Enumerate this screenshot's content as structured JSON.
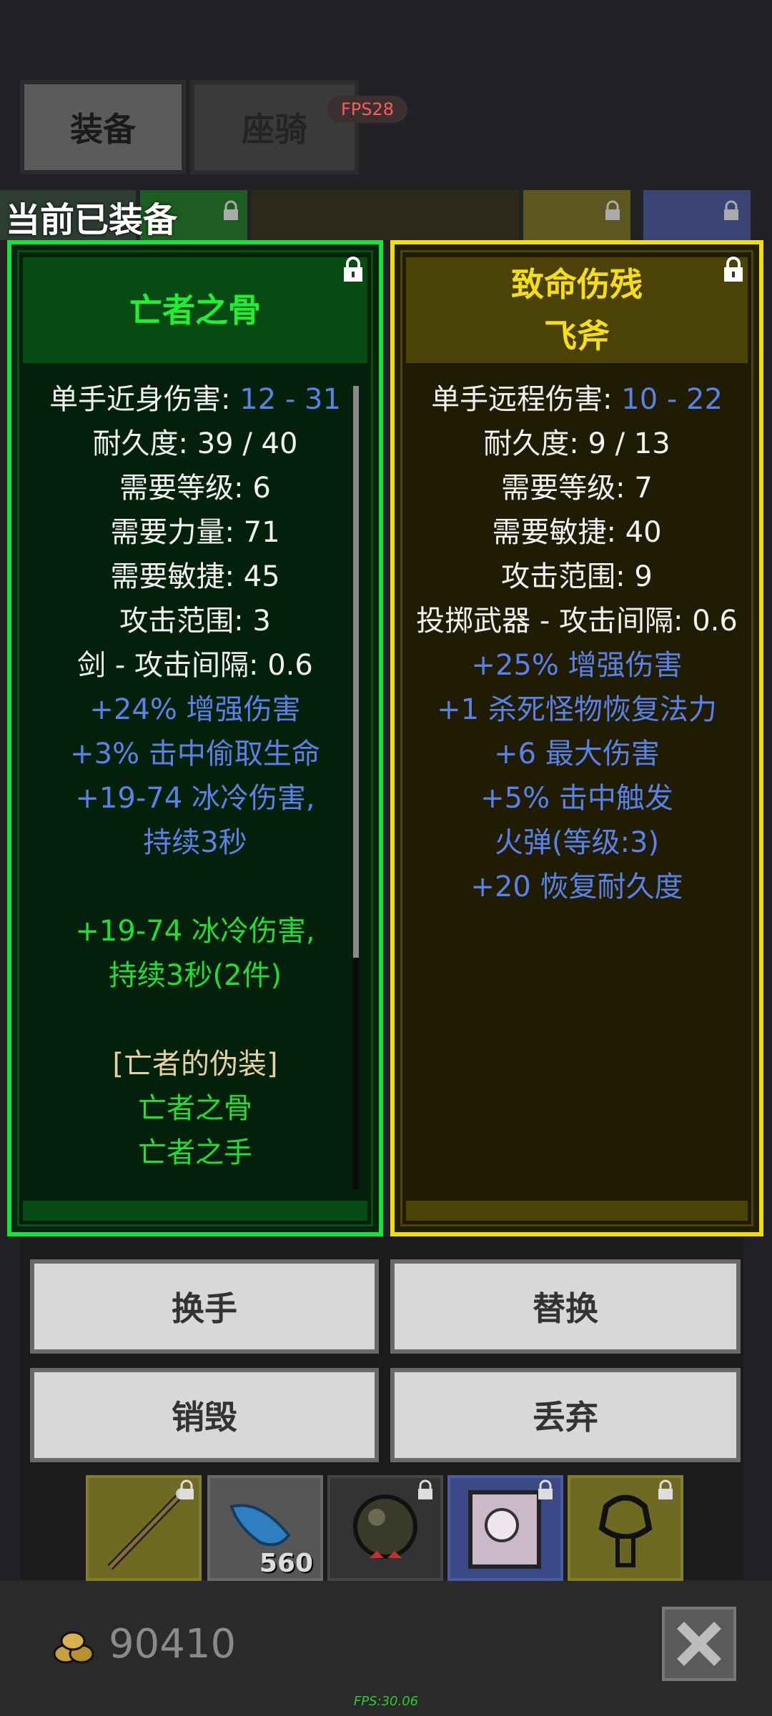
{
  "tabs": {
    "equip_label": "装备",
    "mount_label": "座骑"
  },
  "fps_badge": "FPS28",
  "equipped_title": "当前已装备",
  "left_item": {
    "title_lines": [
      "亡者之骨"
    ],
    "stats": [
      {
        "parts": [
          {
            "t": "单手近身伤害: ",
            "c": "w"
          },
          {
            "t": "12 - 31",
            "c": "b"
          }
        ]
      },
      {
        "parts": [
          {
            "t": "耐久度: 39 / 40",
            "c": "w"
          }
        ]
      },
      {
        "parts": [
          {
            "t": "需要等级: 6",
            "c": "w"
          }
        ]
      },
      {
        "parts": [
          {
            "t": "需要力量: 71",
            "c": "w"
          }
        ]
      },
      {
        "parts": [
          {
            "t": "需要敏捷: 45",
            "c": "w"
          }
        ]
      },
      {
        "parts": [
          {
            "t": "攻击范围: 3",
            "c": "w"
          }
        ]
      },
      {
        "parts": [
          {
            "t": "剑 - 攻击间隔: 0.6",
            "c": "w"
          }
        ]
      },
      {
        "parts": [
          {
            "t": "+24% 增强伤害",
            "c": "b"
          }
        ]
      },
      {
        "parts": [
          {
            "t": "+3% 击中偷取生命",
            "c": "b"
          }
        ]
      },
      {
        "parts": [
          {
            "t": "+19-74 冰冷伤害,",
            "c": "b"
          }
        ]
      },
      {
        "parts": [
          {
            "t": "持续3秒",
            "c": "b"
          }
        ]
      },
      {
        "gap": true
      },
      {
        "parts": [
          {
            "t": "+19-74 冰冷伤害,",
            "c": "g"
          }
        ]
      },
      {
        "parts": [
          {
            "t": "持续3秒(2件)",
            "c": "g"
          }
        ]
      },
      {
        "gap": true
      },
      {
        "parts": [
          {
            "t": "[亡者的伪装]",
            "c": "t"
          }
        ]
      },
      {
        "parts": [
          {
            "t": "亡者之骨",
            "c": "g"
          }
        ]
      },
      {
        "parts": [
          {
            "t": "亡者之手",
            "c": "g"
          }
        ]
      }
    ]
  },
  "right_item": {
    "title_lines": [
      "致命伤残",
      "飞斧"
    ],
    "stats": [
      {
        "parts": [
          {
            "t": "单手远程伤害: ",
            "c": "w"
          },
          {
            "t": "10 - 22",
            "c": "b"
          }
        ]
      },
      {
        "parts": [
          {
            "t": "耐久度: 9 / 13",
            "c": "w"
          }
        ]
      },
      {
        "parts": [
          {
            "t": "需要等级: 7",
            "c": "w"
          }
        ]
      },
      {
        "parts": [
          {
            "t": "需要敏捷: 40",
            "c": "w"
          }
        ]
      },
      {
        "parts": [
          {
            "t": "攻击范围: 9",
            "c": "w"
          }
        ]
      },
      {
        "parts": [
          {
            "t": "投掷武器 - 攻击间隔: 0.6",
            "c": "w"
          }
        ]
      },
      {
        "parts": [
          {
            "t": "+25% 增强伤害",
            "c": "b"
          }
        ]
      },
      {
        "parts": [
          {
            "t": "+1 杀死怪物恢复法力",
            "c": "b"
          }
        ]
      },
      {
        "parts": [
          {
            "t": "+6 最大伤害",
            "c": "b"
          }
        ]
      },
      {
        "parts": [
          {
            "t": "+5% 击中触发",
            "c": "b"
          }
        ]
      },
      {
        "parts": [
          {
            "t": "火弹(等级:3)",
            "c": "b"
          }
        ]
      },
      {
        "parts": [
          {
            "t": "+20 恢复耐久度",
            "c": "b"
          }
        ]
      }
    ]
  },
  "actions": {
    "swap_hand": "换手",
    "replace": "替换",
    "destroy": "销毁",
    "discard": "丢弃"
  },
  "inventory": {
    "slots": [
      {
        "icon": "staff-icon",
        "count": ""
      },
      {
        "icon": "feather-icon",
        "count": "560"
      },
      {
        "icon": "orb-icon",
        "count": ""
      },
      {
        "icon": "scroll-icon",
        "count": ""
      },
      {
        "icon": "ring-icon",
        "count": ""
      }
    ]
  },
  "gold": {
    "icon": "gold-coins-icon",
    "value": "90410"
  },
  "fps_footer": "FPS:30.06",
  "colors": {
    "green_frame": "#1ee03c",
    "yellow_frame": "#f0dc10",
    "stat_blue": "#5a82e6",
    "set_green": "#22dd33",
    "set_tan": "#e6d29c"
  }
}
